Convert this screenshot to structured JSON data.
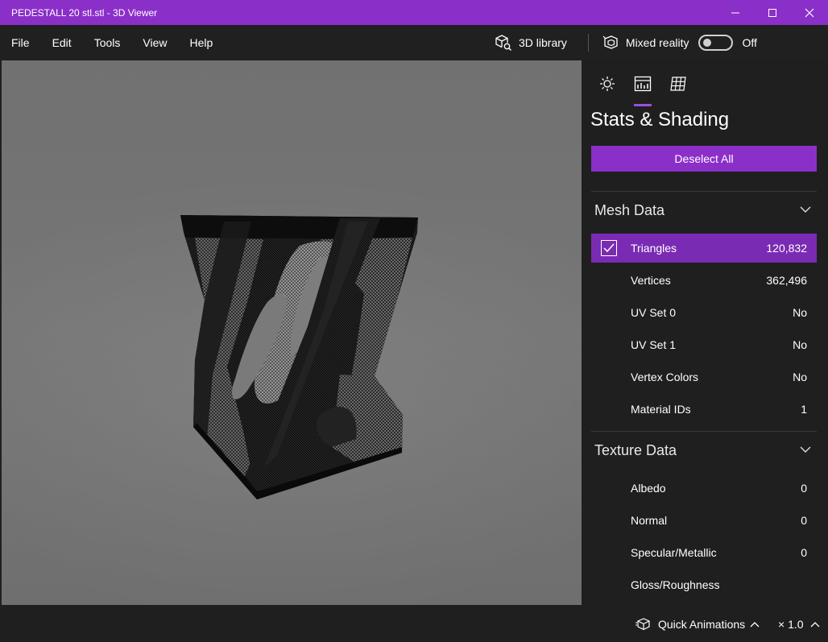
{
  "window": {
    "title": "PEDESTALL 20 stl.stl - 3D Viewer",
    "controls": [
      "minimize-icon",
      "maximize-icon",
      "close-icon"
    ]
  },
  "menu": {
    "items": [
      "File",
      "Edit",
      "Tools",
      "View",
      "Help"
    ],
    "library_label": "3D library",
    "mixed_reality_label": "Mixed reality",
    "mixed_reality_state": "Off"
  },
  "panel": {
    "tabs": [
      {
        "icon": "sun-icon",
        "active": false
      },
      {
        "icon": "stats-icon",
        "active": true
      },
      {
        "icon": "grid-icon",
        "active": false
      }
    ],
    "title": "Stats & Shading",
    "deselect_label": "Deselect All",
    "mesh_section": {
      "title": "Mesh Data",
      "rows": [
        {
          "label": "Triangles",
          "value": "120,832",
          "selected": true
        },
        {
          "label": "Vertices",
          "value": "362,496"
        },
        {
          "label": "UV Set 0",
          "value": "No"
        },
        {
          "label": "UV Set 1",
          "value": "No"
        },
        {
          "label": "Vertex Colors",
          "value": "No"
        },
        {
          "label": "Material IDs",
          "value": "1"
        }
      ]
    },
    "texture_section": {
      "title": "Texture Data",
      "rows": [
        {
          "label": "Albedo",
          "value": "0"
        },
        {
          "label": "Normal",
          "value": "0"
        },
        {
          "label": "Specular/Metallic",
          "value": "0"
        },
        {
          "label": "Gloss/Roughness",
          "value": ""
        }
      ]
    }
  },
  "bottom": {
    "quick_animations_label": "Quick Animations",
    "speed_label": "× 1.0"
  },
  "colors": {
    "accent": "#8b2fc9",
    "background": "#202020",
    "viewport": "#7a7a7a"
  }
}
